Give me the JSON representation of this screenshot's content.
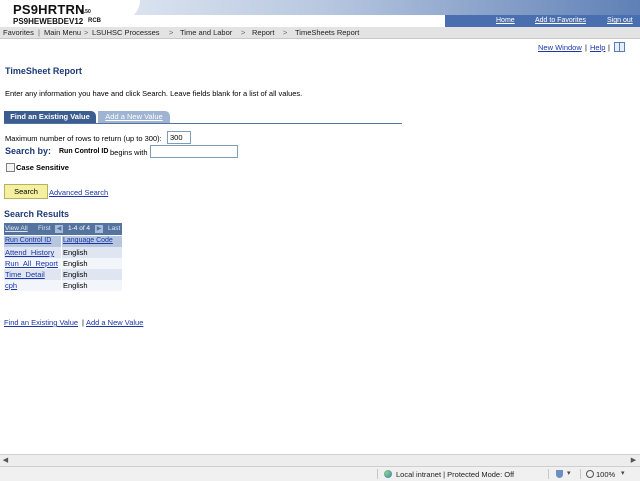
{
  "header": {
    "app_title": "PS9HRTRN",
    "app_version": "8.50",
    "db_name": "PS9HEWEBDEV12",
    "db_user": "RCB",
    "links": [
      "Home",
      "Add to Favorites",
      "Sign out"
    ]
  },
  "breadcrumb": [
    "Favorites",
    "Main Menu",
    "LSUHSC Processes",
    "Time and Labor",
    "Report",
    "TimeSheets Report"
  ],
  "page_links": [
    "New Window",
    "Help"
  ],
  "page_title": "TimeSheet Report",
  "instructions": "Enter any information you have and click Search. Leave fields blank for a list of all values.",
  "tabs": [
    "Find an Existing Value",
    "Add a New Value"
  ],
  "search": {
    "max_rows_label": "Maximum number of rows to return (up to 300):",
    "max_rows_value": "300",
    "search_by_label": "Search by:",
    "field_label": "Run Control ID",
    "operator": "begins with",
    "field_value": "",
    "case_sensitive_label": "Case Sensitive",
    "search_button": "Search",
    "advanced_search": "Advanced Search"
  },
  "results": {
    "title": "Search Results",
    "nav": {
      "view_all": "View All",
      "first": "First",
      "range": "1-4 of 4",
      "last": "Last"
    },
    "columns": [
      "Run Control ID",
      "Language Code"
    ],
    "rows": [
      [
        "Attend_History",
        "English"
      ],
      [
        "Run_All_Report",
        "English"
      ],
      [
        "Time_Detail",
        "English"
      ],
      [
        "cph",
        "English"
      ]
    ]
  },
  "footer_links": [
    "Find an Existing Value",
    "Add a New Value"
  ],
  "statusbar": {
    "zone": "Local intranet | Protected Mode: Off",
    "zoom": "100%"
  }
}
